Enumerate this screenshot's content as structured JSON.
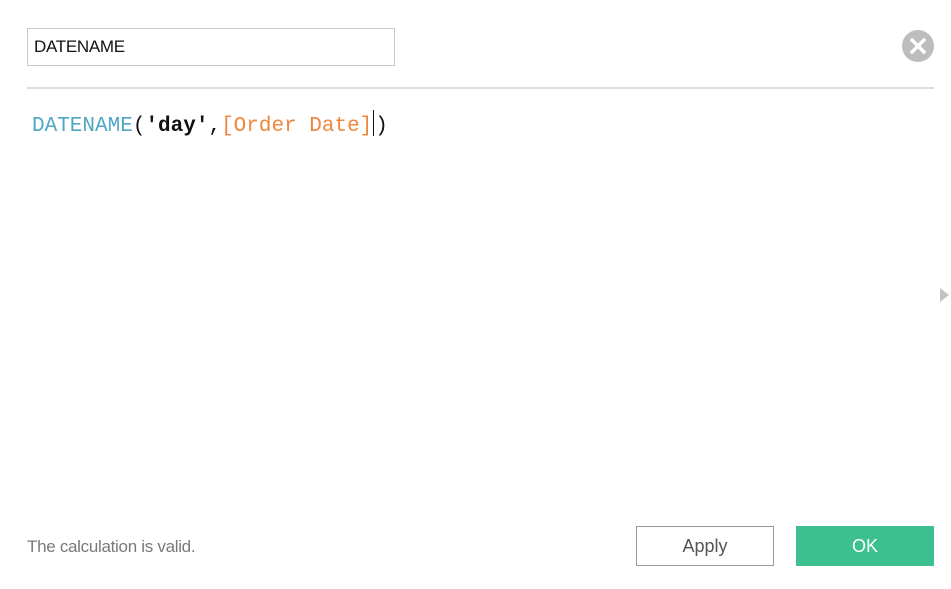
{
  "dialog": {
    "calc_name": "DATENAME",
    "close_icon": "close-circle-icon",
    "expand_icon": "triangle-right-icon"
  },
  "editor": {
    "tokens": {
      "function": "DATENAME",
      "open_paren": "(",
      "string_arg": "'day'",
      "comma": ",",
      "field_ref": "[Order Date]",
      "close_paren": ")"
    }
  },
  "footer": {
    "status": "The calculation is valid.",
    "apply_label": "Apply",
    "ok_label": "OK"
  },
  "colors": {
    "function": "#4fa7c6",
    "field": "#f0863c",
    "ok_button": "#3cc08f"
  }
}
